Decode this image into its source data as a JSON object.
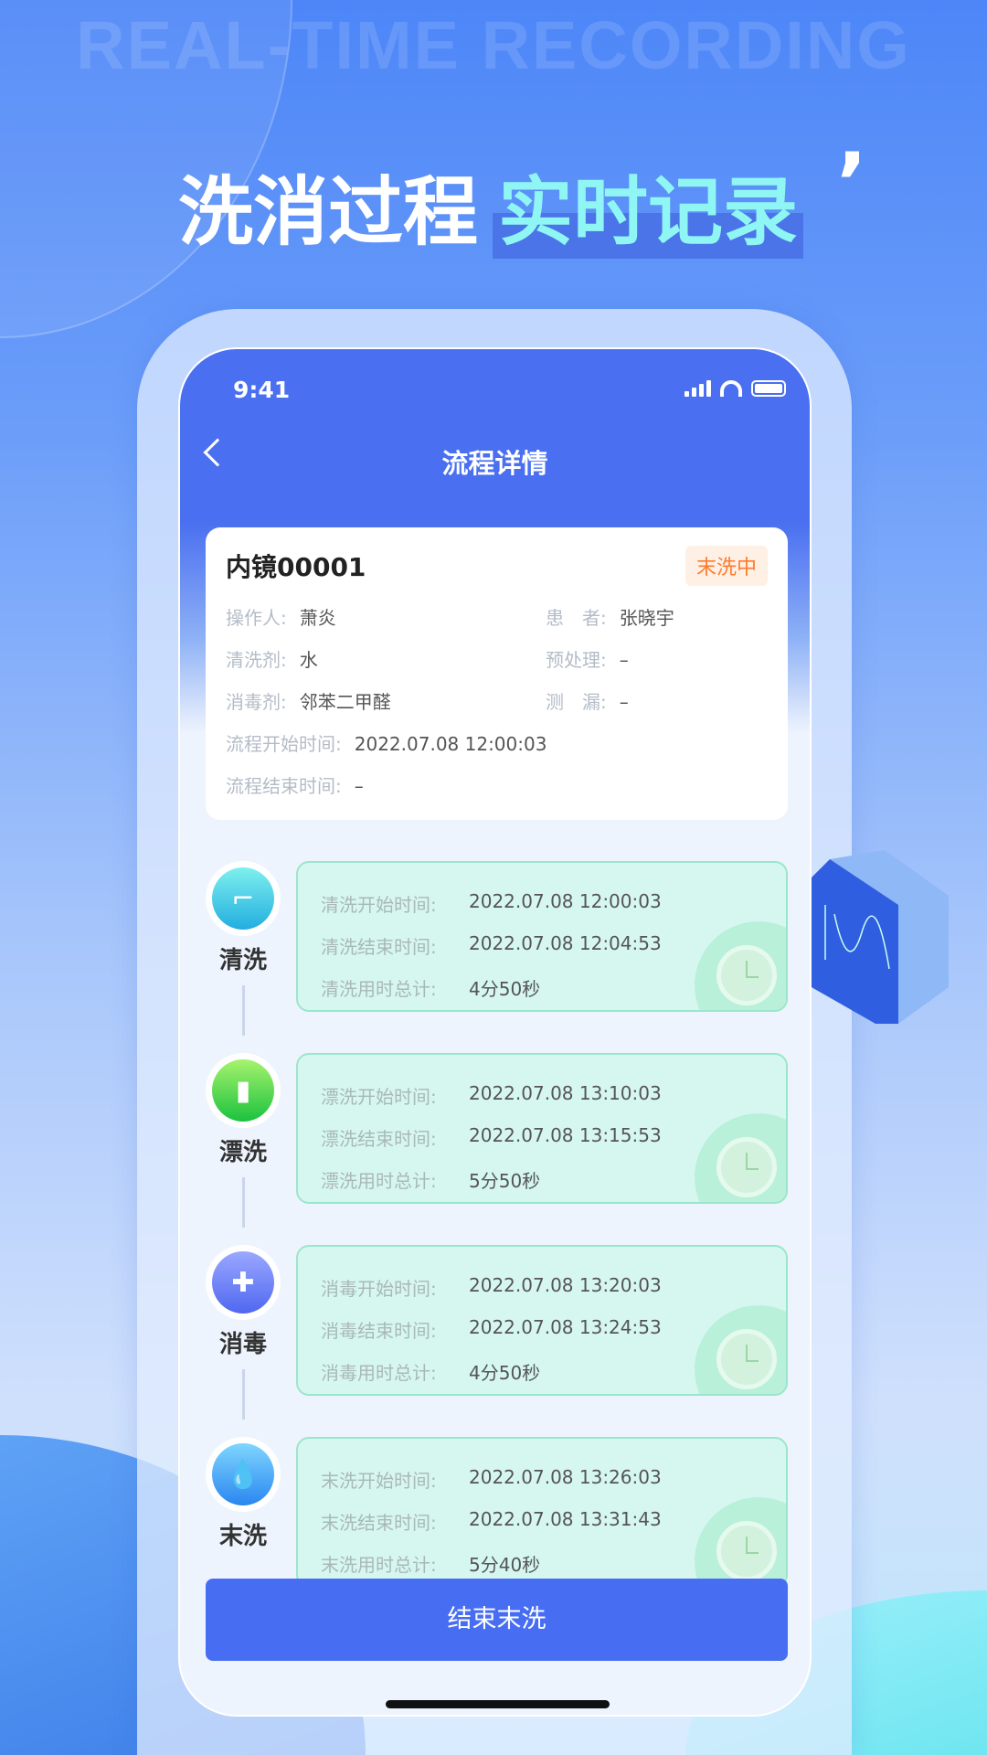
{
  "banner": {
    "watermark": "REAL-TIME RECORDING",
    "headline_a": "洗消过程",
    "headline_b": "实时记录"
  },
  "status": {
    "time": "9:41"
  },
  "nav": {
    "title": "流程详情"
  },
  "info": {
    "name": "内镜00001",
    "status": "末洗中",
    "status_color": "#ff7a2b",
    "operator_label": "操作人:",
    "operator": "萧炎",
    "patient_label": "患　者:",
    "patient": "张晓宇",
    "cleaner_label": "清洗剂:",
    "cleaner": "水",
    "pretreat_label": "预处理:",
    "pretreat": "–",
    "disinfectant_label": "消毒剂:",
    "disinfectant": "邻苯二甲醛",
    "leak_label": "测　漏:",
    "leak": "–",
    "start_label": "流程开始时间:",
    "start": "2022.07.08 12:00:03",
    "end_label": "流程结束时间:",
    "end": "–"
  },
  "steps": [
    {
      "name": "清洗",
      "icon": "faucet-icon",
      "start_label": "清洗开始时间:",
      "start": "2022.07.08 12:00:03",
      "end_label": "清洗结束时间:",
      "end": "2022.07.08 12:04:53",
      "total_label": "清洗用时总计:",
      "total": "4分50秒"
    },
    {
      "name": "漂洗",
      "icon": "bottle-icon",
      "start_label": "漂洗开始时间:",
      "start": "2022.07.08 13:10:03",
      "end_label": "漂洗结束时间:",
      "end": "2022.07.08 13:15:53",
      "total_label": "漂洗用时总计:",
      "total": "5分50秒"
    },
    {
      "name": "消毒",
      "icon": "spray-icon",
      "start_label": "消毒开始时间:",
      "start": "2022.07.08 13:20:03",
      "end_label": "消毒结束时间:",
      "end": "2022.07.08 13:24:53",
      "total_label": "消毒用时总计:",
      "total": "4分50秒"
    },
    {
      "name": "末洗",
      "icon": "water-drop-icon",
      "start_label": "末洗开始时间:",
      "start": "2022.07.08 13:26:03",
      "end_label": "末洗结束时间:",
      "end": "2022.07.08 13:31:43",
      "total_label": "末洗用时总计:",
      "total": "5分40秒"
    }
  ],
  "action": {
    "label": "结束末洗",
    "color": "#476df2"
  }
}
